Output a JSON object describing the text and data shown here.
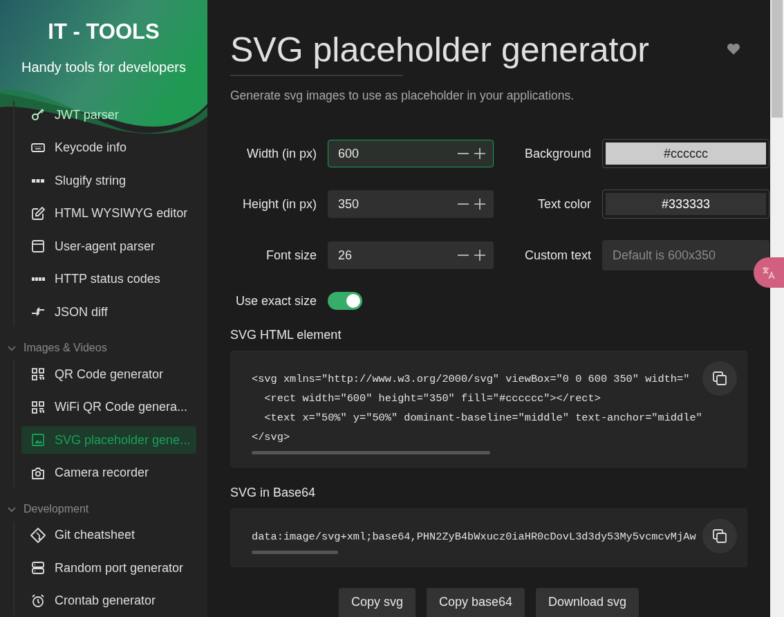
{
  "sidebar": {
    "header": {
      "title": "IT - TOOLS",
      "subtitle": "Handy tools for developers"
    },
    "groups": [
      {
        "expanded": true,
        "items": [
          {
            "label": "JWT parser",
            "kind": "key",
            "selected": false
          },
          {
            "label": "Keycode info",
            "kind": "keyboard",
            "selected": false
          },
          {
            "label": "Slugify string",
            "kind": "abc",
            "selected": false
          },
          {
            "label": "HTML WYSIWYG editor",
            "kind": "pencil",
            "selected": false
          },
          {
            "label": "User-agent parser",
            "kind": "window",
            "selected": false
          },
          {
            "label": "HTTP status codes",
            "kind": "http",
            "selected": false
          },
          {
            "label": "JSON diff",
            "kind": "arrows",
            "selected": false
          }
        ]
      },
      {
        "label": "Images & Videos",
        "expanded": true,
        "items": [
          {
            "label": "QR Code generator",
            "kind": "qr",
            "selected": false
          },
          {
            "label": "WiFi QR Code genera...",
            "kind": "qr",
            "selected": false
          },
          {
            "label": "SVG placeholder gene...",
            "kind": "image",
            "selected": true
          },
          {
            "label": "Camera recorder",
            "kind": "camera",
            "selected": false
          }
        ]
      },
      {
        "label": "Development",
        "expanded": true,
        "items": [
          {
            "label": "Git cheatsheet",
            "kind": "git",
            "selected": false
          },
          {
            "label": "Random port generator",
            "kind": "server",
            "selected": false
          },
          {
            "label": "Crontab generator",
            "kind": "alarm",
            "selected": false
          }
        ]
      }
    ]
  },
  "main": {
    "title": "SVG placeholder generator",
    "favorite": false,
    "description": "Generate svg images to use as placeholder in your applications.",
    "fields": [
      {
        "label": "Width (in px)",
        "kind": "number",
        "value": "600",
        "focused": true
      },
      {
        "label": "Background",
        "kind": "color",
        "value": "#cccccc"
      },
      {
        "label": "Height (in px)",
        "kind": "number",
        "value": "350",
        "focused": false
      },
      {
        "label": "Text color",
        "kind": "color",
        "value": "#333333"
      },
      {
        "label": "Font size",
        "kind": "number",
        "value": "26",
        "focused": false
      },
      {
        "label": "Custom text",
        "kind": "text",
        "placeholder": "Default is 600x350"
      },
      {
        "label": "Use exact size",
        "kind": "switch",
        "on": true
      }
    ],
    "outputs": [
      {
        "label": "SVG HTML element",
        "lines": [
          "<svg xmlns=\"http://www.w3.org/2000/svg\" viewBox=\"0 0 600 350\" width=\"",
          "  <rect width=\"600\" height=\"350\" fill=\"#cccccc\"></rect>",
          "  <text x=\"50%\" y=\"50%\" dominant-baseline=\"middle\" text-anchor=\"middle\"",
          "</svg>"
        ]
      },
      {
        "label": "SVG in Base64",
        "lines": [
          "data:image/svg+xml;base64,PHN2ZyB4bWxucz0iaHR0cDovL3d3dy53My5vcmcvMjAw"
        ]
      }
    ],
    "buttons": [
      "Copy svg",
      "Copy base64",
      "Download svg"
    ]
  }
}
